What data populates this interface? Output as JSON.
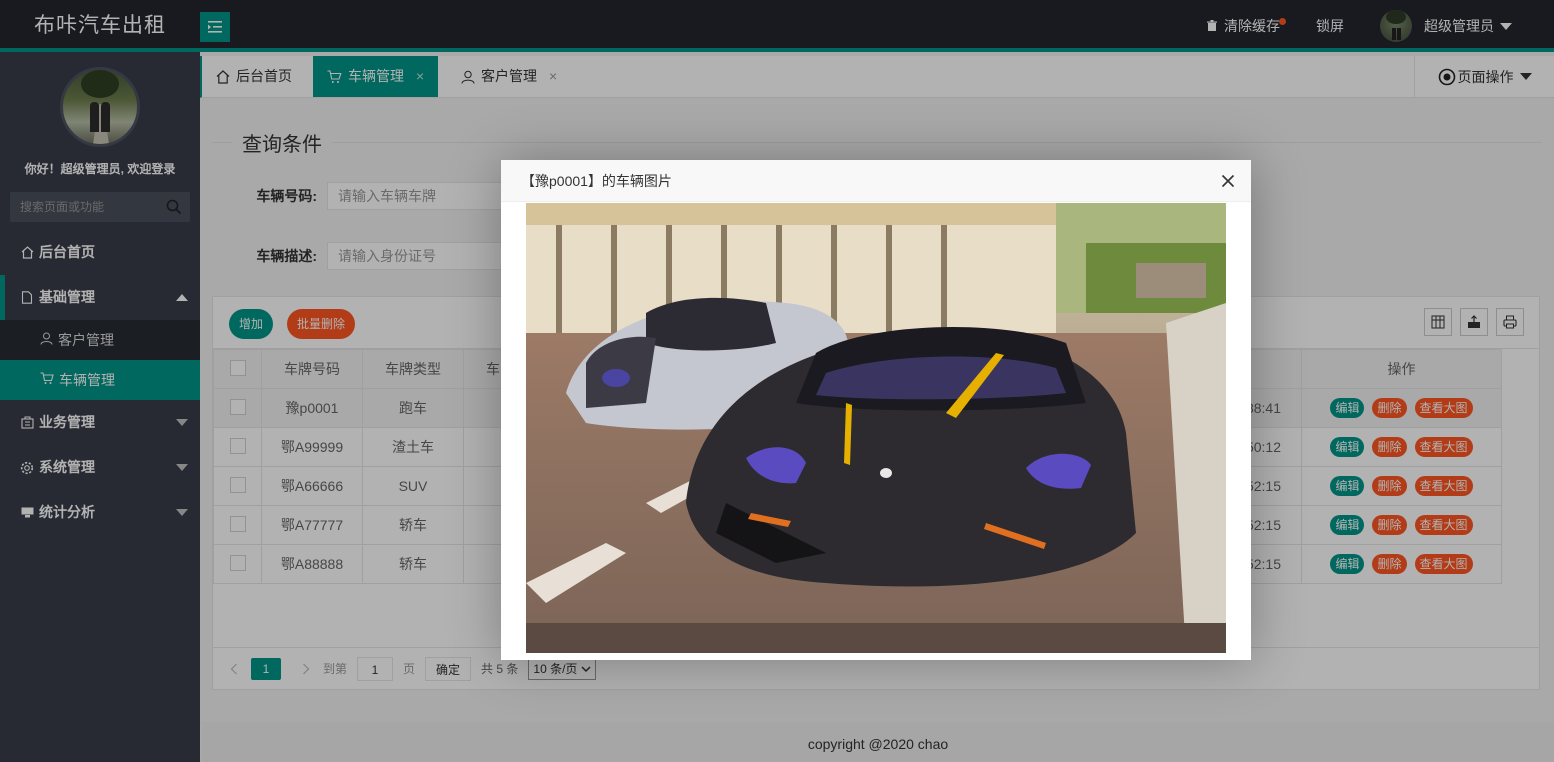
{
  "header": {
    "logo": "布咔汽车出租",
    "clear_cache": "清除缓存",
    "lock_screen": "锁屏",
    "username": "超级管理员"
  },
  "sidebar": {
    "welcome": "你好！超级管理员, 欢迎登录",
    "search_placeholder": "搜索页面或功能",
    "items": [
      {
        "label": "后台首页"
      },
      {
        "label": "基础管理"
      },
      {
        "label": "业务管理"
      },
      {
        "label": "系统管理"
      },
      {
        "label": "统计分析"
      }
    ],
    "sub_items": [
      {
        "label": "客户管理"
      },
      {
        "label": "车辆管理"
      }
    ]
  },
  "tabs": [
    {
      "label": "后台首页"
    },
    {
      "label": "车辆管理",
      "close": "×"
    },
    {
      "label": "客户管理",
      "close": "×"
    }
  ],
  "page_ops": "页面操作",
  "query": {
    "legend": "查询条件",
    "plate_label": "车辆号码:",
    "plate_placeholder": "请输入车辆车牌",
    "desc_label": "车辆描述:",
    "desc_placeholder": "请输入身份证号"
  },
  "toolbar": {
    "add": "增加",
    "batch_delete": "批量删除"
  },
  "table": {
    "headers": {
      "plate": "车牌号码",
      "type": "车牌类型",
      "partial": "车",
      "ops": "操作"
    },
    "rows": [
      {
        "plate": "豫p0001",
        "type": "跑车",
        "time": "38:41"
      },
      {
        "plate": "鄂A99999",
        "type": "渣土车",
        "time": "50:12"
      },
      {
        "plate": "鄂A66666",
        "type": "SUV",
        "time": "52:15"
      },
      {
        "plate": "鄂A77777",
        "type": "轿车",
        "time": "52:15"
      },
      {
        "plate": "鄂A88888",
        "type": "轿车",
        "time": "52:15"
      }
    ],
    "row_ops": {
      "edit": "编辑",
      "delete": "删除",
      "view": "查看大图"
    }
  },
  "pager": {
    "current": "1",
    "goto": "到第",
    "page_input": "1",
    "page_unit": "页",
    "confirm": "确定",
    "total": "共 5 条",
    "page_size": "10 条/页"
  },
  "footer": "copyright @2020 chao",
  "modal": {
    "title": "【豫p0001】的车辆图片"
  },
  "colors": {
    "accent": "#009688",
    "danger": "#ff5722",
    "header_bg": "#23262e",
    "sidebar_bg": "#393d49"
  }
}
